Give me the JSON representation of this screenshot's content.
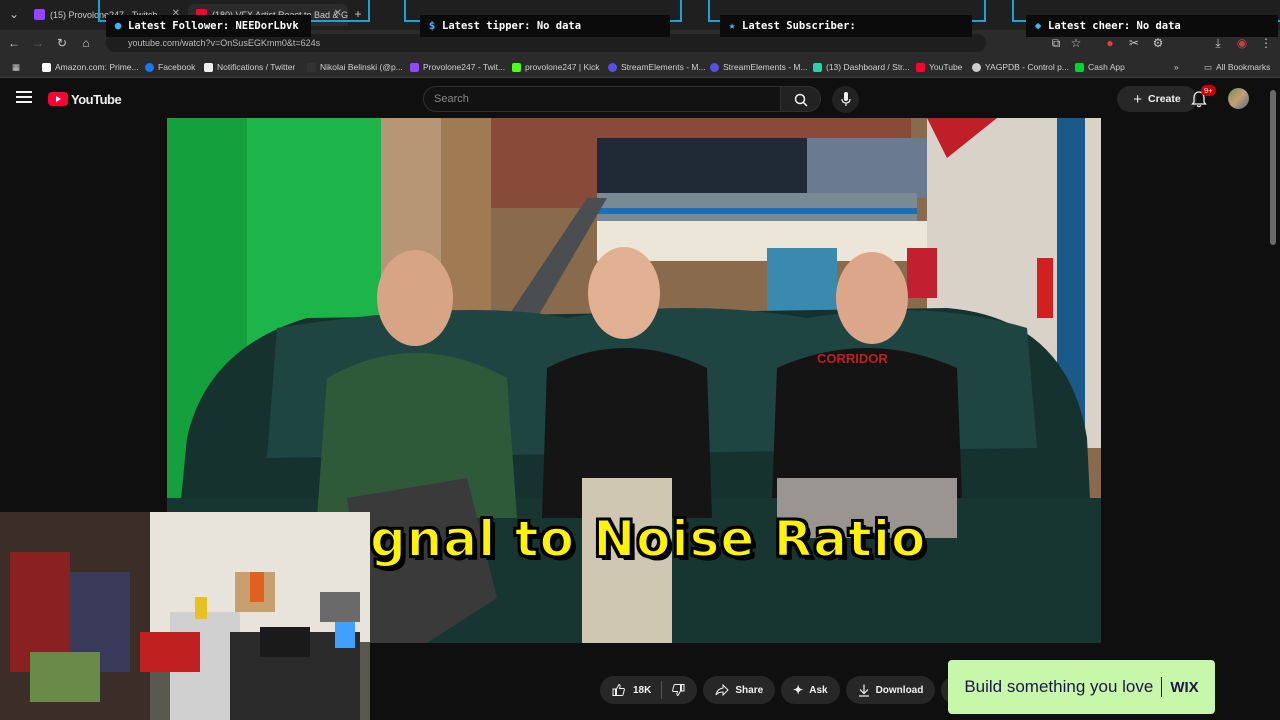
{
  "browser": {
    "tabs": [
      {
        "label": "(15) Provolone247 - Twitch",
        "color": "#9146ff"
      },
      {
        "label": "(180) VFX Artist React to Bad & Great...",
        "color": "#ff0033"
      }
    ],
    "url": "youtube.com/watch?v=OnSusEGKmm0&t=624s",
    "bookmarks": [
      {
        "label": "Amazon.com: Prime...",
        "color": "#ffffff"
      },
      {
        "label": "Facebook",
        "color": "#1877f2"
      },
      {
        "label": "Notifications / Twitter",
        "color": "#ffffff"
      },
      {
        "label": "Nikolai Belinski (@p...",
        "color": "#111111"
      },
      {
        "label": "Provolone247 - Twit...",
        "color": "#9146ff"
      },
      {
        "label": "provolone247 | Kick",
        "color": "#53fc18"
      },
      {
        "label": "StreamElements - M...",
        "color": "#5b4ee0"
      },
      {
        "label": "StreamElements - M...",
        "color": "#5b4ee0"
      },
      {
        "label": "(13) Dashboard / Str...",
        "color": "#2ad3a4"
      },
      {
        "label": "YouTube",
        "color": "#ff0033"
      },
      {
        "label": "YAGPDB - Control p...",
        "color": "#cccccc"
      },
      {
        "label": "Cash App",
        "color": "#00d632"
      }
    ],
    "all_bookmarks": "All Bookmarks"
  },
  "overlays": {
    "follower": "Latest Follower: NEEDorLbvk",
    "tipper": "Latest tipper: No data",
    "subscriber": "Latest Subscriber:",
    "cheer": "Latest cheer: No data"
  },
  "youtube": {
    "logo_text": "YouTube",
    "search_placeholder": "Search",
    "create_label": "Create",
    "notification_badge": "9+"
  },
  "video": {
    "caption": "gnal to Noise Ratio",
    "shirt_text": "CORRIDOR"
  },
  "actions": {
    "likes": "18K",
    "share": "Share",
    "ask": "Ask",
    "download": "Download"
  },
  "ad": {
    "text": "Build something you love",
    "brand": "WIX"
  }
}
